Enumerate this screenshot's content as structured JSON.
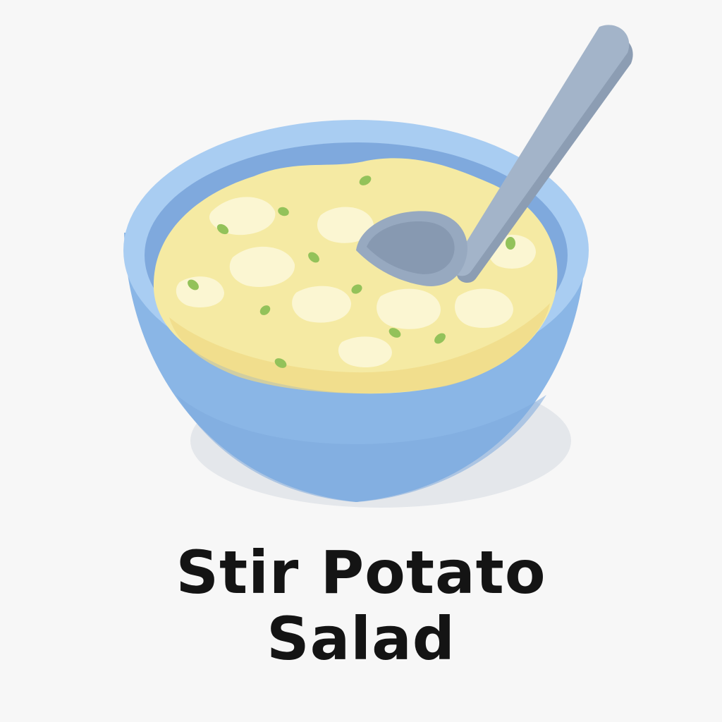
{
  "caption": {
    "line1": "Stir Potato",
    "line2": "Salad"
  },
  "illustration": {
    "icons": [
      "bowl-icon",
      "potato-salad-icon",
      "spoon-icon",
      "chive-icon"
    ]
  },
  "colors": {
    "background": "#f7f7f7",
    "bowl": "#8ab6e6",
    "bowl_rim": "#a9cdf2",
    "bowl_inner": "#7fa9dd",
    "salad": "#f5eaa3",
    "salad_highlight": "#fbf6d2",
    "chives": "#93c25a",
    "spoon": "#a3b4c9",
    "spoon_shadow": "#8c9db3",
    "text": "#141414"
  }
}
